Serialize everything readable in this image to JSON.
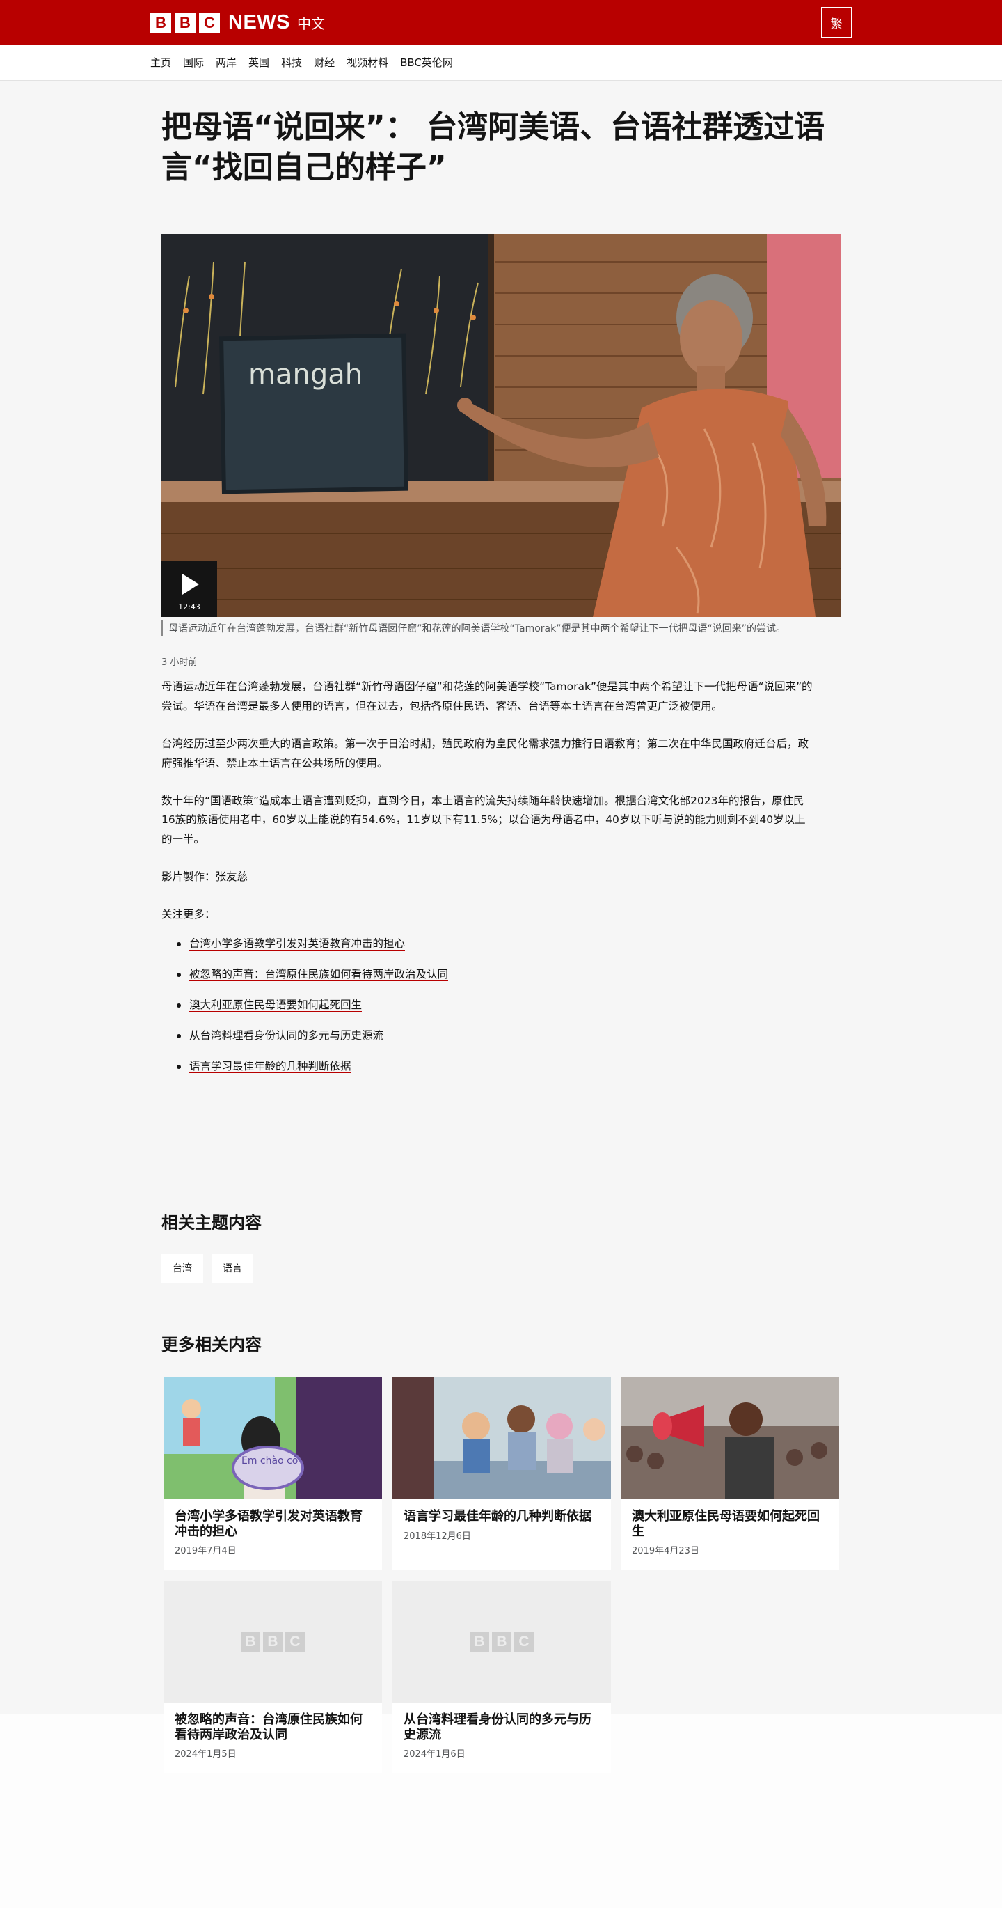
{
  "header": {
    "logo_letters": [
      "B",
      "B",
      "C"
    ],
    "brand_news": "NEWS",
    "brand_lang": "中文",
    "trad_toggle": "繁"
  },
  "nav": {
    "items": [
      {
        "label": "主页"
      },
      {
        "label": "国际"
      },
      {
        "label": "两岸"
      },
      {
        "label": "英国"
      },
      {
        "label": "科技"
      },
      {
        "label": "财经"
      },
      {
        "label": "视频材料"
      },
      {
        "label": "BBC英伦网"
      }
    ]
  },
  "article": {
    "headline": "把母语“说回来”： 台湾阿美语、台语社群透过语言“找回自己的样子”",
    "video": {
      "duration": "12:43",
      "chalkboard_text": "mangah",
      "icon": "play-icon"
    },
    "caption": "母语运动近年在台湾蓬勃发展，台语社群“新竹母语囡仔窟”和花莲的阿美语学校“Tamorak”便是其中两个希望让下一代把母语“说回来”的尝试。",
    "timestamp": "3 小时前",
    "paragraphs": [
      "母语运动近年在台湾蓬勃发展，台语社群“新竹母语囡仔窟”和花莲的阿美语学校“Tamorak”便是其中两个希望让下一代把母语“说回来”的尝试。华语在台湾是最多人使用的语言，但在过去，包括各原住民语、客语、台语等本土语言在台湾曾更广泛被使用。",
      "台湾经历过至少两次重大的语言政策。第一次于日治时期，殖民政府为皇民化需求强力推行日语教育；第二次在中华民国政府迁台后，政府强推华语、禁止本土语言在公共场所的使用。",
      "数十年的“国语政策”造成本土语言遭到贬抑，直到今日，本土语言的流失持续随年龄快速增加。根据台湾文化部2023年的报告，原住民16族的族语使用者中，60岁以上能说的有54.6%，11岁以下有11.5%；以台语为母语者中，40岁以下听与说的能力则剩不到40岁以上的一半。",
      "影片製作：张友慈",
      "关注更多："
    ],
    "links": [
      "台湾小学多语教学引发对英语教育冲击的担心",
      "被忽略的声音：台湾原住民族如何看待两岸政治及认同",
      "澳大利亚原住民母语要如何起死回生",
      "从台湾料理看身份认同的多元与历史源流",
      "语言学习最佳年龄的几种判断依据"
    ]
  },
  "related_topics": {
    "title": "相关主题内容",
    "tags": [
      "台湾",
      "语言"
    ]
  },
  "more_related": {
    "title": "更多相关内容",
    "cards": [
      {
        "title": "台湾小学多语教学引发对英语教育冲击的担心",
        "date": "2019年7月4日",
        "image": "photo",
        "image_text": "Em chào cô"
      },
      {
        "title": "语言学习最佳年龄的几种判断依据",
        "date": "2018年12月6日",
        "image": "photo"
      },
      {
        "title": "澳大利亚原住民母语要如何起死回生",
        "date": "2019年4月23日",
        "image": "photo"
      },
      {
        "title": "被忽略的声音：台湾原住民族如何看待两岸政治及认同",
        "date": "2024年1月5日",
        "image": "placeholder"
      },
      {
        "title": "从台湾料理看身份认同的多元与历史源流",
        "date": "2024年1月6日",
        "image": "placeholder"
      }
    ]
  },
  "colors": {
    "brand_red": "#b80000",
    "page_bg": "#f6f6f6",
    "text": "#141414",
    "muted": "#545658"
  }
}
